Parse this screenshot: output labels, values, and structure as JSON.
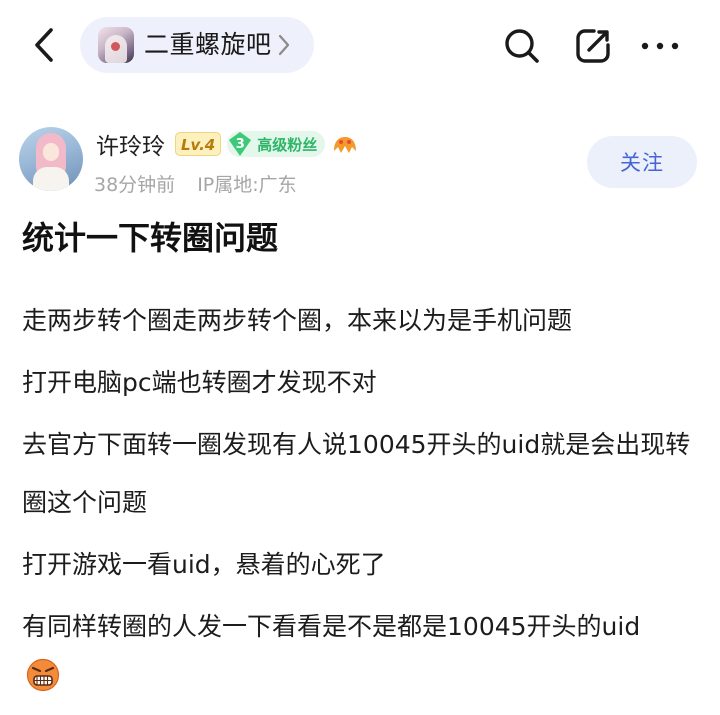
{
  "header": {
    "back_icon": "chevron-left-icon",
    "forum_name": "二重螺旋吧",
    "forum_chevron_icon": "chevron-right-icon",
    "search_icon": "search-icon",
    "share_icon": "share-edit-icon",
    "more_icon": "more-horizontal-icon"
  },
  "author": {
    "name": "许玲玲",
    "level": "Lv.4",
    "fan_level": "3",
    "fan_label": "高级粉丝",
    "decor_icon": "decor-emoji-icon",
    "time": "38分钟前",
    "ip": "IP属地:广东",
    "follow_label": "关注"
  },
  "post": {
    "title": "统计一下转圈问题",
    "paragraphs": [
      "走两步转个圈走两步转个圈，本来以为是手机问题",
      "打开电脑pc端也转圈才发现不对",
      "去官方下面转一圈发现有人说10045开头的uid就是会出现转圈这个问题",
      "打开游戏一看uid，悬着的心死了",
      "有同样转圈的人发一下看看是不是都是10045开头的uid"
    ],
    "end_emoji_icon": "angry-face-emoji-icon"
  },
  "colors": {
    "accent": "#4465d6",
    "fan_green": "#2fb56a",
    "meta_gray": "#a6a6a6",
    "pill_bg": "#eef0fb"
  }
}
